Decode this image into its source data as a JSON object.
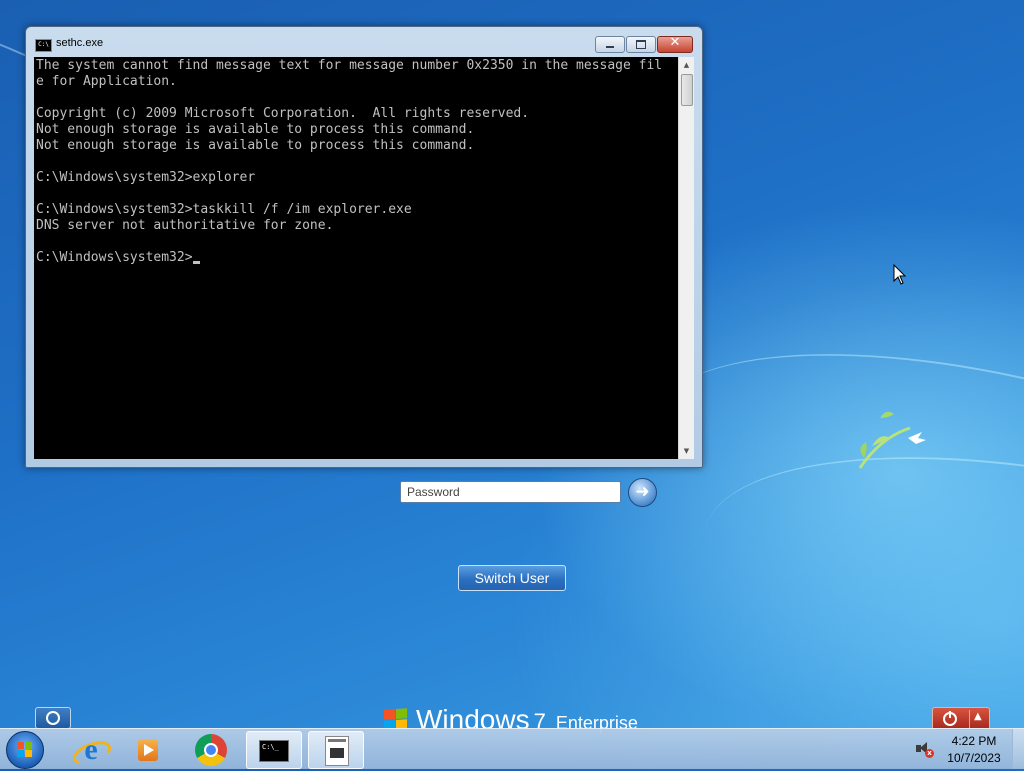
{
  "console": {
    "title": "sethc.exe",
    "title_icon": "cmd-icon",
    "lines": [
      "The system cannot find message text for message number 0x2350 in the message fil",
      "e for Application.",
      "",
      "Copyright (c) 2009 Microsoft Corporation.  All rights reserved.",
      "Not enough storage is available to process this command.",
      "Not enough storage is available to process this command.",
      "",
      "C:\\Windows\\system32>explorer",
      "",
      "C:\\Windows\\system32>taskkill /f /im explorer.exe",
      "DNS server not authoritative for zone.",
      ""
    ],
    "prompt": "C:\\Windows\\system32>",
    "colors": {
      "background": "#000000",
      "text": "#c0c0c0"
    }
  },
  "logon": {
    "password_placeholder": "Password",
    "password_value": "",
    "switch_user_label": "Switch User"
  },
  "branding": {
    "windows": "Windows",
    "version": "7",
    "edition": "Enterprise"
  },
  "taskbar": {
    "items": [
      {
        "name": "internet-explorer",
        "icon": "ie-icon",
        "running": false
      },
      {
        "name": "windows-media-player",
        "icon": "wmp-icon",
        "running": false
      },
      {
        "name": "google-chrome",
        "icon": "chrome-icon",
        "running": false
      },
      {
        "name": "command-prompt",
        "icon": "cmd-icon",
        "running": true
      },
      {
        "name": "sethc",
        "icon": "sethc-icon",
        "running": true
      }
    ],
    "clock": {
      "time": "4:22 PM",
      "date": "10/7/2023"
    },
    "volume_state": "muted"
  },
  "colors": {
    "desktop": "#1e6fc6",
    "taskbar": "#a8c3e2",
    "shutdown": "#c0392b"
  }
}
